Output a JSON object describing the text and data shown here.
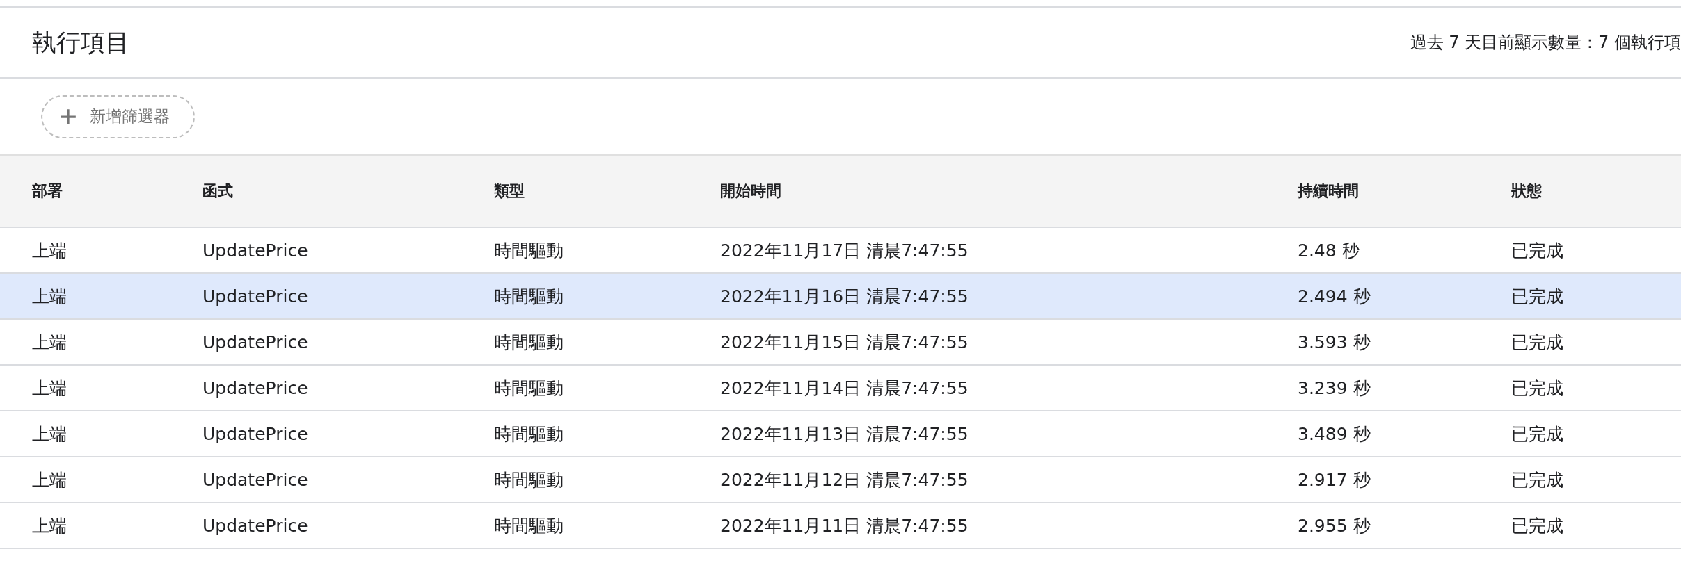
{
  "header": {
    "title": "執行項目",
    "summary": "過去 7 天目前顯示數量：7 個執行項"
  },
  "filter_button": {
    "label": "新增篩選器"
  },
  "table": {
    "columns": [
      "部署",
      "函式",
      "類型",
      "開始時間",
      "持續時間",
      "狀態"
    ],
    "rows": [
      {
        "selected": false,
        "cells": [
          "上端",
          "UpdatePrice",
          "時間驅動",
          "2022年11月17日 清晨7:47:55",
          "2.48 秒",
          "已完成"
        ]
      },
      {
        "selected": true,
        "cells": [
          "上端",
          "UpdatePrice",
          "時間驅動",
          "2022年11月16日 清晨7:47:55",
          "2.494 秒",
          "已完成"
        ]
      },
      {
        "selected": false,
        "cells": [
          "上端",
          "UpdatePrice",
          "時間驅動",
          "2022年11月15日 清晨7:47:55",
          "3.593 秒",
          "已完成"
        ]
      },
      {
        "selected": false,
        "cells": [
          "上端",
          "UpdatePrice",
          "時間驅動",
          "2022年11月14日 清晨7:47:55",
          "3.239 秒",
          "已完成"
        ]
      },
      {
        "selected": false,
        "cells": [
          "上端",
          "UpdatePrice",
          "時間驅動",
          "2022年11月13日 清晨7:47:55",
          "3.489 秒",
          "已完成"
        ]
      },
      {
        "selected": false,
        "cells": [
          "上端",
          "UpdatePrice",
          "時間驅動",
          "2022年11月12日 清晨7:47:55",
          "2.917 秒",
          "已完成"
        ]
      },
      {
        "selected": false,
        "cells": [
          "上端",
          "UpdatePrice",
          "時間驅動",
          "2022年11月11日 清晨7:47:55",
          "2.955 秒",
          "已完成"
        ]
      }
    ]
  }
}
